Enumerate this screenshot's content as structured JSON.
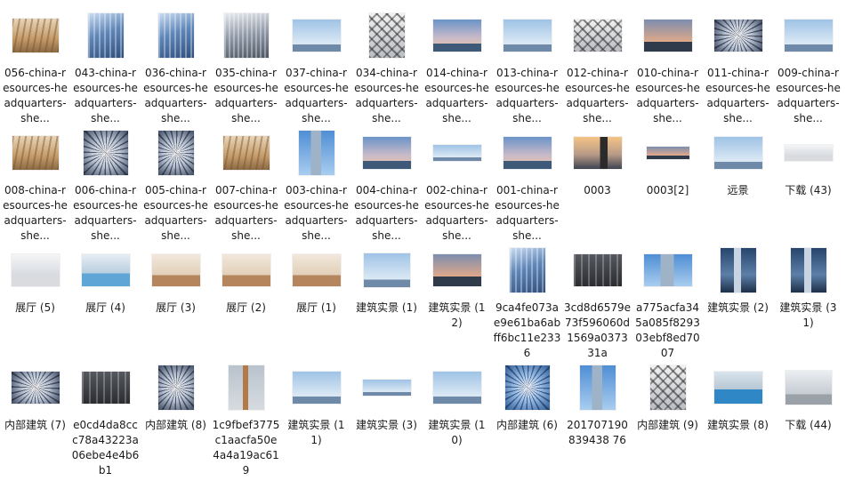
{
  "files": [
    {
      "name": "056-china-resources-headquarters-she...",
      "thumb_icon": "interior-photo-thumbnail-icon",
      "thumb_style": "g-interior-wood",
      "thumb_shape": "t-land"
    },
    {
      "name": "043-china-resources-headquarters-she...",
      "thumb_icon": "tower-photo-thumbnail-icon",
      "thumb_style": "g-glass-blue",
      "thumb_shape": "t-tall"
    },
    {
      "name": "036-china-resources-headquarters-she...",
      "thumb_icon": "tower-photo-thumbnail-icon",
      "thumb_style": "g-glass-blue",
      "thumb_shape": "t-tall"
    },
    {
      "name": "035-china-resources-headquarters-she...",
      "thumb_icon": "facade-photo-thumbnail-icon",
      "thumb_style": "g-glass-grey",
      "thumb_shape": "t-sq"
    },
    {
      "name": "037-china-resources-headquarters-she...",
      "thumb_icon": "skyline-photo-thumbnail-icon",
      "thumb_style": "g-skyline",
      "thumb_shape": "t-wide"
    },
    {
      "name": "034-china-resources-headquarters-she...",
      "thumb_icon": "structure-photo-thumbnail-icon",
      "thumb_style": "g-structure",
      "thumb_shape": "t-tall"
    },
    {
      "name": "014-china-resources-headquarters-she...",
      "thumb_icon": "skyline-photo-thumbnail-icon",
      "thumb_style": "g-skyline-warm",
      "thumb_shape": "t-wide"
    },
    {
      "name": "013-china-resources-headquarters-she...",
      "thumb_icon": "skyline-photo-thumbnail-icon",
      "thumb_style": "g-skyline",
      "thumb_shape": "t-wide"
    },
    {
      "name": "012-china-resources-headquarters-she...",
      "thumb_icon": "structure-photo-thumbnail-icon",
      "thumb_style": "g-structure",
      "thumb_shape": "t-wide"
    },
    {
      "name": "010-china-resources-headquarters-she...",
      "thumb_icon": "skyline-photo-thumbnail-icon",
      "thumb_style": "g-skyline-dusk",
      "thumb_shape": "t-wide"
    },
    {
      "name": "011-china-resources-headquarters-she...",
      "thumb_icon": "dome-photo-thumbnail-icon",
      "thumb_style": "g-dome",
      "thumb_shape": "t-wide"
    },
    {
      "name": "009-china-resources-headquarters-she...",
      "thumb_icon": "skyline-photo-thumbnail-icon",
      "thumb_style": "g-skyline",
      "thumb_shape": "t-wide"
    },
    {
      "name": "008-china-resources-headquarters-she...",
      "thumb_icon": "interior-photo-thumbnail-icon",
      "thumb_style": "g-interior-wood",
      "thumb_shape": "t-land"
    },
    {
      "name": "006-china-resources-headquarters-she...",
      "thumb_icon": "dome-photo-thumbnail-icon",
      "thumb_style": "g-dome",
      "thumb_shape": "t-sq"
    },
    {
      "name": "005-china-resources-headquarters-she...",
      "thumb_icon": "dome-photo-thumbnail-icon",
      "thumb_style": "g-dome",
      "thumb_shape": "t-tall"
    },
    {
      "name": "007-china-resources-headquarters-she...",
      "thumb_icon": "interior-photo-thumbnail-icon",
      "thumb_style": "g-interior-wood",
      "thumb_shape": "t-land"
    },
    {
      "name": "003-china-resources-headquarters-she...",
      "thumb_icon": "tower-photo-thumbnail-icon",
      "thumb_style": "g-tower-day",
      "thumb_shape": "t-tall"
    },
    {
      "name": "004-china-resources-headquarters-she...",
      "thumb_icon": "skyline-photo-thumbnail-icon",
      "thumb_style": "g-skyline-warm",
      "thumb_shape": "t-wide"
    },
    {
      "name": "002-china-resources-headquarters-she...",
      "thumb_icon": "skyline-photo-thumbnail-icon",
      "thumb_style": "g-skyline",
      "thumb_shape": "t-pano"
    },
    {
      "name": "001-china-resources-headquarters-she...",
      "thumb_icon": "skyline-photo-thumbnail-icon",
      "thumb_style": "g-skyline-warm",
      "thumb_shape": "t-wide"
    },
    {
      "name": "0003",
      "thumb_icon": "skyline-photo-thumbnail-icon",
      "thumb_style": "g-sunset-tower",
      "thumb_shape": "t-wide"
    },
    {
      "name": "0003[2]",
      "thumb_icon": "skyline-photo-thumbnail-icon",
      "thumb_style": "g-skyline-dusk",
      "thumb_shape": "t-strip"
    },
    {
      "name": "远景",
      "thumb_icon": "skyline-photo-thumbnail-icon",
      "thumb_style": "g-skyline",
      "thumb_shape": "t-wide"
    },
    {
      "name": "下载 (43)",
      "thumb_icon": "lobby-photo-thumbnail-icon",
      "thumb_style": "g-lobby",
      "thumb_shape": "t-pano"
    },
    {
      "name": "展厅 (5)",
      "thumb_icon": "lobby-photo-thumbnail-icon",
      "thumb_style": "g-lobby",
      "thumb_shape": "t-wide"
    },
    {
      "name": "展厅 (4)",
      "thumb_icon": "lobby-photo-thumbnail-icon",
      "thumb_style": "g-lobby-blue",
      "thumb_shape": "t-wide"
    },
    {
      "name": "展厅 (3)",
      "thumb_icon": "lobby-photo-thumbnail-icon",
      "thumb_style": "g-lobby-warm",
      "thumb_shape": "t-wide"
    },
    {
      "name": "展厅 (2)",
      "thumb_icon": "lobby-photo-thumbnail-icon",
      "thumb_style": "g-lobby-warm",
      "thumb_shape": "t-wide"
    },
    {
      "name": "展厅 (1)",
      "thumb_icon": "lobby-photo-thumbnail-icon",
      "thumb_style": "g-lobby-warm",
      "thumb_shape": "t-wide"
    },
    {
      "name": "建筑实景 (1)",
      "thumb_icon": "skyline-photo-thumbnail-icon",
      "thumb_style": "g-skyline",
      "thumb_shape": "t-land"
    },
    {
      "name": "建筑实景 (12)",
      "thumb_icon": "skyline-photo-thumbnail-icon",
      "thumb_style": "g-skyline-dusk",
      "thumb_shape": "t-wide"
    },
    {
      "name": "9ca4fe073ae9e61ba6abff6bc11e2336",
      "thumb_icon": "tower-photo-thumbnail-icon",
      "thumb_style": "g-glass-blue",
      "thumb_shape": "t-tall"
    },
    {
      "name": "3cd8d6579e73f596060d1569a037331a",
      "thumb_icon": "interior-photo-thumbnail-icon",
      "thumb_style": "g-dark-interior",
      "thumb_shape": "t-wide"
    },
    {
      "name": "a775acfa345a085f829303ebf8ed7007",
      "thumb_icon": "skyline-photo-thumbnail-icon",
      "thumb_style": "g-tower-day",
      "thumb_shape": "t-wide"
    },
    {
      "name": "建筑实景 (2)",
      "thumb_icon": "tower-photo-thumbnail-icon",
      "thumb_style": "g-tower-night",
      "thumb_shape": "t-tall"
    },
    {
      "name": "建筑实景 (31)",
      "thumb_icon": "tower-photo-thumbnail-icon",
      "thumb_style": "g-tower-night",
      "thumb_shape": "t-tall"
    },
    {
      "name": "内部建筑 (7)",
      "thumb_icon": "dome-photo-thumbnail-icon",
      "thumb_style": "g-dome",
      "thumb_shape": "t-wide"
    },
    {
      "name": "e0cd4da8ccc78a43223a06ebe4e4b6b1",
      "thumb_icon": "interior-photo-thumbnail-icon",
      "thumb_style": "g-dark-interior",
      "thumb_shape": "t-wide"
    },
    {
      "name": "内部建筑 (8)",
      "thumb_icon": "dome-photo-thumbnail-icon",
      "thumb_style": "g-dome",
      "thumb_shape": "t-tall"
    },
    {
      "name": "1c9fbef3775c1aacfa50e4a4a19ac619",
      "thumb_icon": "tower-photo-thumbnail-icon",
      "thumb_style": "g-misty",
      "thumb_shape": "t-tall"
    },
    {
      "name": "建筑实景 (11)",
      "thumb_icon": "skyline-photo-thumbnail-icon",
      "thumb_style": "g-skyline",
      "thumb_shape": "t-wide"
    },
    {
      "name": "建筑实景 (3)",
      "thumb_icon": "skyline-photo-thumbnail-icon",
      "thumb_style": "g-skyline",
      "thumb_shape": "t-pano"
    },
    {
      "name": "建筑实景 (10)",
      "thumb_icon": "skyline-photo-thumbnail-icon",
      "thumb_style": "g-skyline",
      "thumb_shape": "t-wide"
    },
    {
      "name": "内部建筑 (6)",
      "thumb_icon": "dome-photo-thumbnail-icon",
      "thumb_style": "g-dome-blue",
      "thumb_shape": "t-sq"
    },
    {
      "name": "201707190839438 76",
      "thumb_icon": "tower-photo-thumbnail-icon",
      "thumb_style": "g-tower-day",
      "thumb_shape": "t-tall"
    },
    {
      "name": "内部建筑 (9)",
      "thumb_icon": "structure-photo-thumbnail-icon",
      "thumb_style": "g-structure",
      "thumb_shape": "t-tall"
    },
    {
      "name": "建筑实景 (8)",
      "thumb_icon": "pool-photo-thumbnail-icon",
      "thumb_style": "g-pool",
      "thumb_shape": "t-wide"
    },
    {
      "name": "下载 (44)",
      "thumb_icon": "corridor-photo-thumbnail-icon",
      "thumb_style": "g-corridor",
      "thumb_shape": "t-land"
    }
  ]
}
